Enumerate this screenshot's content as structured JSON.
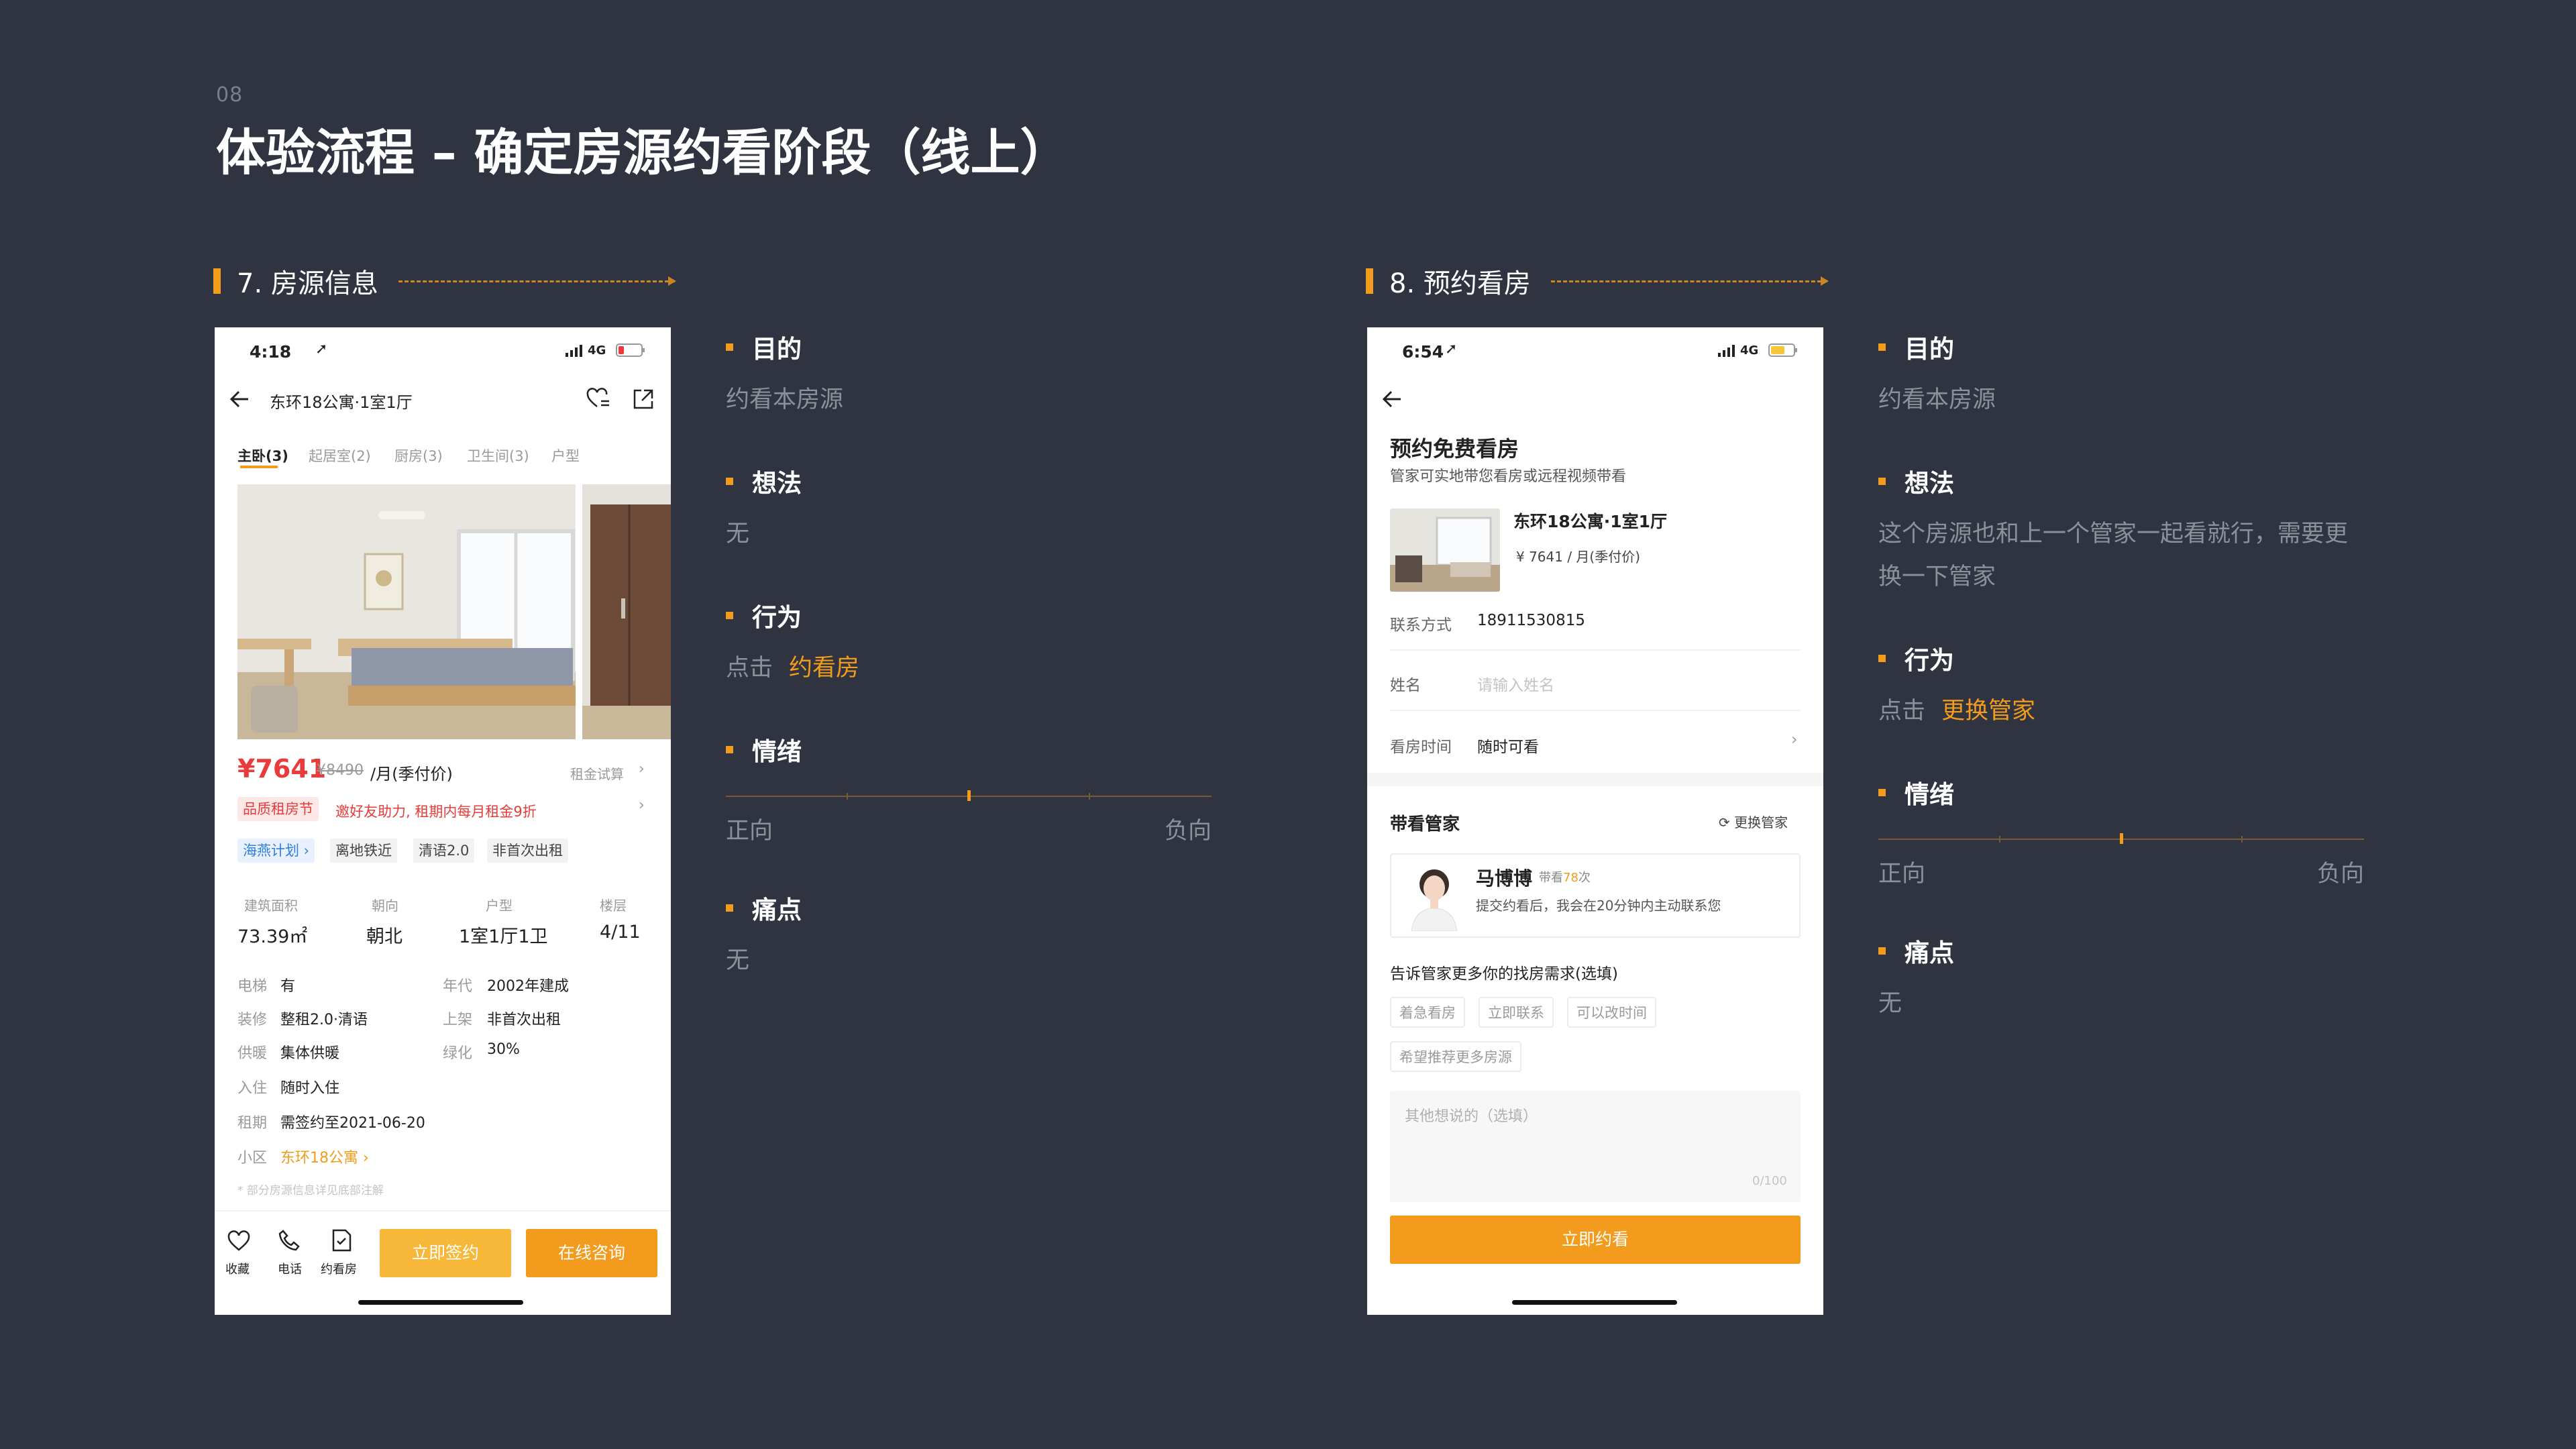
{
  "page": {
    "number": "08",
    "title": "体验流程 – 确定房源约看阶段（线上）",
    "accent": "#f29b1d",
    "background": "#2f3440"
  },
  "sections": [
    {
      "title": "7. 房源信息",
      "annotation": {
        "purpose_label": "目的",
        "purpose": "约看本房源",
        "idea_label": "想法",
        "idea": [
          "无"
        ],
        "action_label": "行为",
        "action_prefix": "点击",
        "action_highlight": "约看房",
        "emotion_label": "情绪",
        "emotion_positive": "正向",
        "emotion_negative": "负向",
        "emotion_level": 0.5,
        "pain_label": "痛点",
        "pain": "无"
      }
    },
    {
      "title": "8. 预约看房",
      "annotation": {
        "purpose_label": "目的",
        "purpose": "约看本房源",
        "idea_label": "想法",
        "idea": [
          "这个房源也和上一个管家一起看就行，需要更",
          "换一下管家"
        ],
        "action_label": "行为",
        "action_prefix": "点击",
        "action_highlight": "更换管家",
        "emotion_label": "情绪",
        "emotion_positive": "正向",
        "emotion_negative": "负向",
        "emotion_level": 0.5,
        "pain_label": "痛点",
        "pain": "无"
      }
    }
  ],
  "phone1": {
    "time": "4:18",
    "network": "4G",
    "nav_title": "东环18公寓·1室1厅",
    "tabs": [
      "主卧(3)",
      "起居室(2)",
      "厨房(3)",
      "卫生间(3)",
      "户型"
    ],
    "price": "¥7641",
    "old_price": "¥8490",
    "price_unit": "/月(季付价)",
    "rent_calc": "租金试算",
    "promo_badge": "品质租房节",
    "promo_text": "邀好友助力, 租期内每月租金9折",
    "tags": [
      "海燕计划",
      "离地铁近",
      "清语2.0",
      "非首次出租"
    ],
    "stats": [
      {
        "label": "建筑面积",
        "value": "73.39㎡"
      },
      {
        "label": "朝向",
        "value": "朝北"
      },
      {
        "label": "户型",
        "value": "1室1厅1卫"
      },
      {
        "label": "楼层",
        "value": "4/11"
      }
    ],
    "details": {
      "elevator_label": "电梯",
      "elevator": "有",
      "year_label": "年代",
      "year": "2002年建成",
      "decor_label": "装修",
      "decor": "整租2.0·清语",
      "listed_label": "上架",
      "listed": "非首次出租",
      "heating_label": "供暖",
      "heating": "集体供暖",
      "green_label": "绿化",
      "green": "30%",
      "move_label": "入住",
      "move": "随时入住",
      "term_label": "租期",
      "term": "需签约至2021-06-20",
      "community_label": "小区",
      "community": "东环18公寓"
    },
    "footnote": "* 部分房源信息详见底部注解",
    "bottom": {
      "fav": "收藏",
      "phone": "电话",
      "view": "约看房",
      "sign": "立即签约",
      "consult": "在线咨询"
    }
  },
  "phone2": {
    "time": "6:54",
    "network": "4G",
    "title": "预约免费看房",
    "subtitle": "管家可实地带您看房或远程视频带看",
    "house_name": "东环18公寓·1室1厅",
    "house_price": "¥ 7641 / 月(季付价)",
    "contact_label": "联系方式",
    "contact_value": "18911530815",
    "name_label": "姓名",
    "name_placeholder": "请输入姓名",
    "time_label": "看房时间",
    "time_value": "随时可看",
    "agent_section": "带看管家",
    "change_agent": "更换管家",
    "agent_name": "马博博",
    "agent_count_prefix": "带看",
    "agent_count": "78",
    "agent_count_suffix": "次",
    "agent_note": "提交约看后，我会在20分钟内主动联系您",
    "needs_title": "告诉管家更多你的找房需求(选填)",
    "chips": [
      "着急看房",
      "立即联系",
      "可以改时间",
      "希望推荐更多房源"
    ],
    "textarea_placeholder": "其他想说的（选填）",
    "textarea_count": "0/100",
    "submit": "立即约看"
  }
}
